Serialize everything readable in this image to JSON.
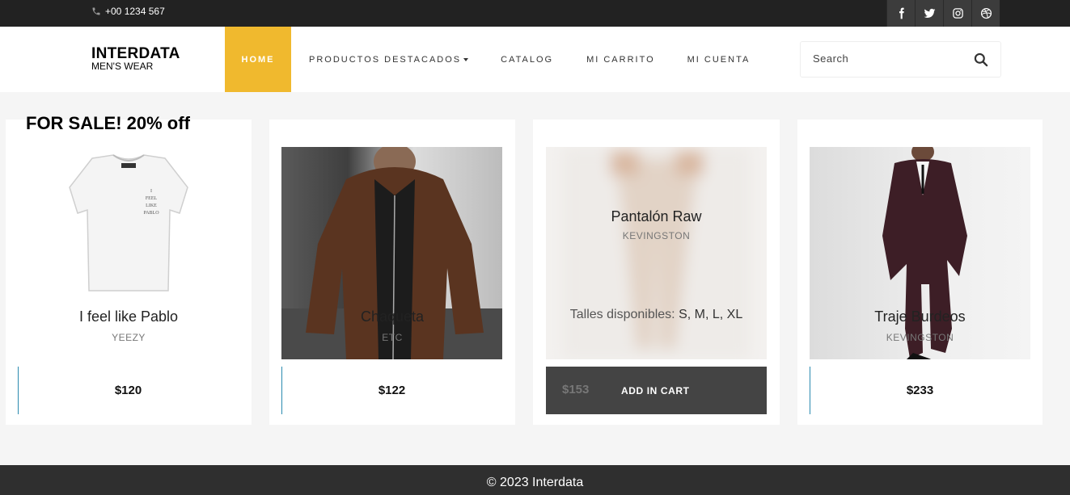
{
  "topbar": {
    "phone": "+00 1234 567",
    "socials": [
      {
        "icon": "facebook-icon"
      },
      {
        "icon": "twitter-icon"
      },
      {
        "icon": "instagram-icon"
      },
      {
        "icon": "dribbble-icon"
      }
    ]
  },
  "brand": {
    "name": "INTERDATA",
    "tagline": "MEN'S WEAR"
  },
  "nav": {
    "items": [
      {
        "label": "HOME",
        "active": true
      },
      {
        "label": "PRODUCTOS DESTACADOS",
        "dropdown": true
      },
      {
        "label": "CATALOG"
      },
      {
        "label": "MI CARRITO"
      },
      {
        "label": "MI CUENTA"
      }
    ]
  },
  "search": {
    "placeholder": "Search",
    "icon": "search-icon"
  },
  "products": [
    {
      "badge": "FOR SALE! 20% off",
      "title": "I feel like Pablo",
      "brand": "YEEZY",
      "price": "$120"
    },
    {
      "title": "Chaqueta",
      "brand": "ETC",
      "price": "$122"
    },
    {
      "title": "Pantalón Raw",
      "brand": "KEVINGSTON",
      "price": "$153",
      "sizes_label": "Talles disponibles:",
      "sizes": "S, M, L, XL",
      "cart_label": "ADD IN CART"
    },
    {
      "title": "Traje Burdeos",
      "brand": "KEVINGSTON",
      "price": "$233"
    }
  ],
  "footer": {
    "text": "© 2023 Interdata"
  },
  "colors": {
    "accent": "#f0b92e",
    "topbar": "#222222",
    "footer": "#2f2f2f",
    "price_line": "#2b8bb0",
    "cart_bar": "#444444"
  }
}
